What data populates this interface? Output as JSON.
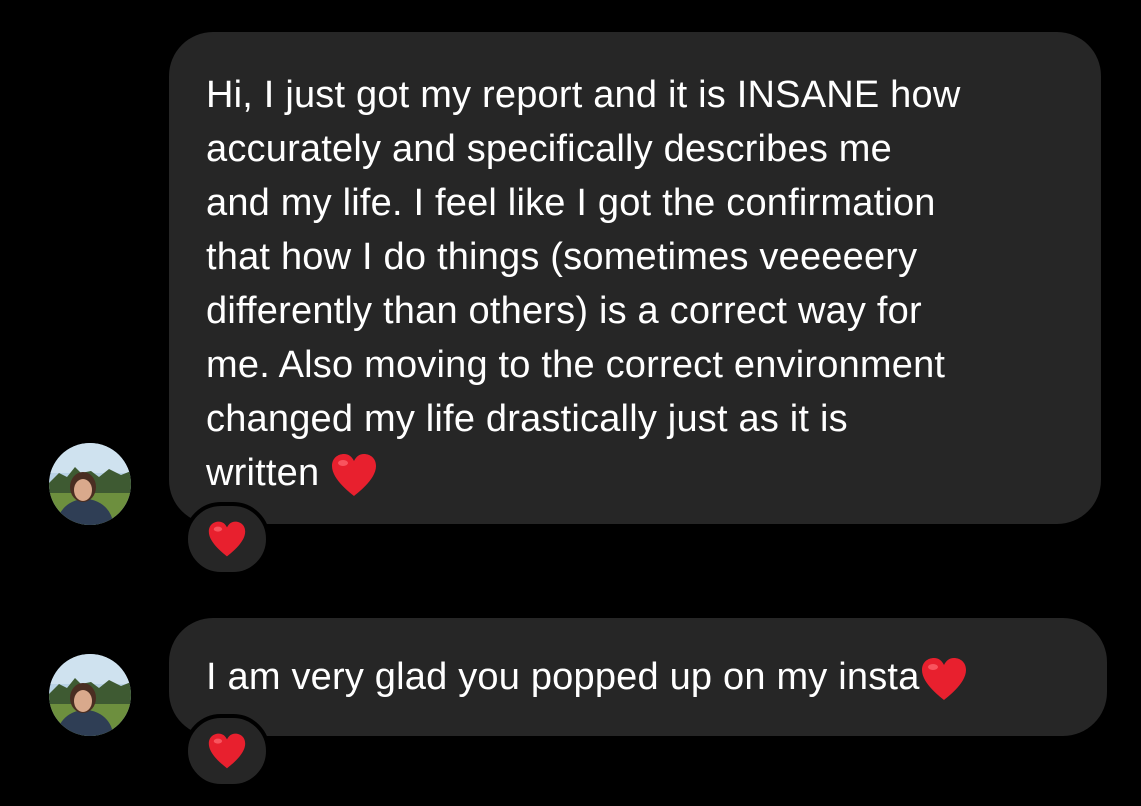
{
  "thread": {
    "messages": [
      {
        "lines": [
          "Hi, I just got my report and it is INSANE how",
          "accurately and specifically describes me",
          "and my life. I feel like I got the confirmation",
          "that how I do things (sometimes veeeeery",
          "differently than others) is a correct way for",
          "me. Also moving to the correct environment",
          "changed my life drastically just as it is",
          "written"
        ],
        "inline_emoji": "heart-emoji",
        "reaction_emoji": "heart-emoji"
      },
      {
        "lines": [
          "I am very glad you popped up on my insta"
        ],
        "inline_emoji": "heart-emoji",
        "reaction_emoji": "heart-emoji"
      }
    ]
  },
  "colors": {
    "background": "#000000",
    "bubble": "#262626",
    "text": "#ffffff",
    "heart": "#e8202e"
  }
}
